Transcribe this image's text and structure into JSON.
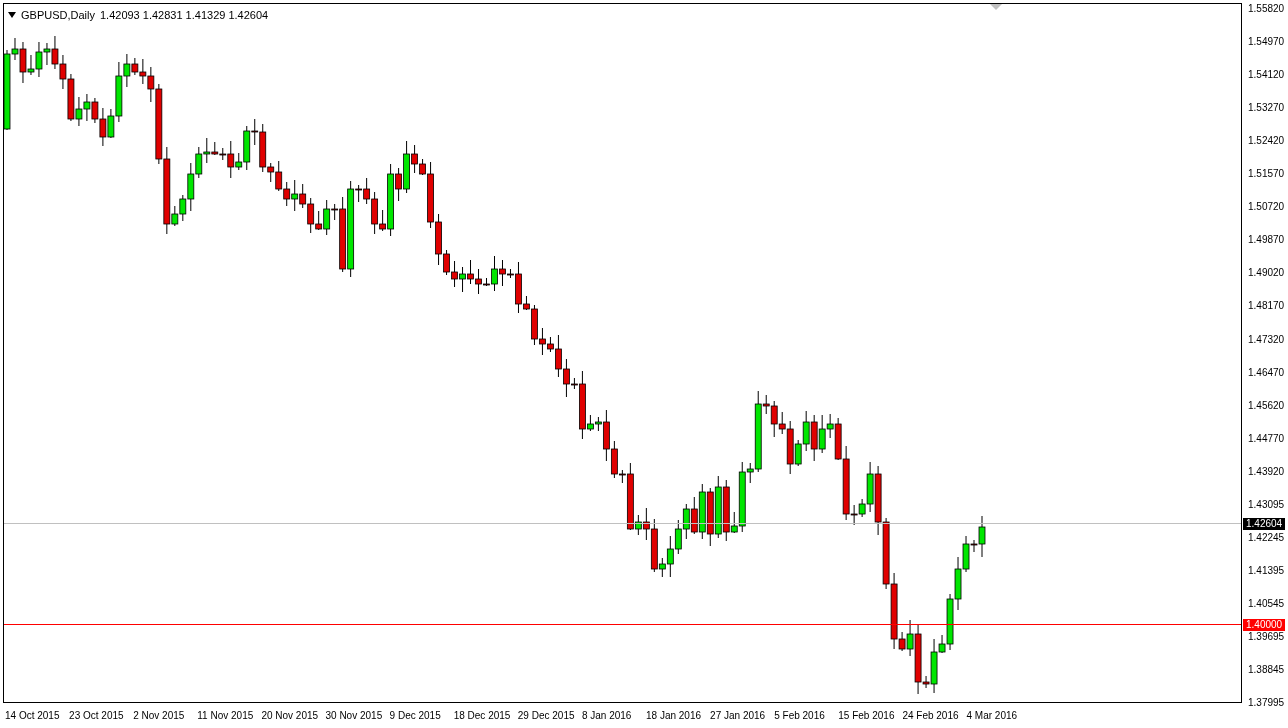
{
  "chart": {
    "symbol": "GBPUSD,Daily",
    "ohlc": [
      "1.42093",
      "1.42831",
      "1.41329",
      "1.42604"
    ]
  },
  "price_axis": [
    "1.55820",
    "1.54970",
    "1.54120",
    "1.53270",
    "1.52420",
    "1.51570",
    "1.50720",
    "1.49870",
    "1.49020",
    "1.48170",
    "1.47320",
    "1.46470",
    "1.45620",
    "1.44770",
    "1.43920",
    "1.43095",
    "1.42245",
    "1.41395",
    "1.40545",
    "1.39695",
    "1.38845",
    "1.37995"
  ],
  "date_axis": [
    "14 Oct 2015",
    "23 Oct 2015",
    "2 Nov 2015",
    "11 Nov 2015",
    "20 Nov 2015",
    "30 Nov 2015",
    "9 Dec 2015",
    "18 Dec 2015",
    "29 Dec 2015",
    "8 Jan 2016",
    "18 Jan 2016",
    "27 Jan 2016",
    "5 Feb 2016",
    "15 Feb 2016",
    "24 Feb 2016",
    "4 Mar 2016"
  ],
  "current_price": {
    "label": "1.42604"
  },
  "level_line": {
    "label": "1.40000",
    "color": "#ff0000"
  }
}
